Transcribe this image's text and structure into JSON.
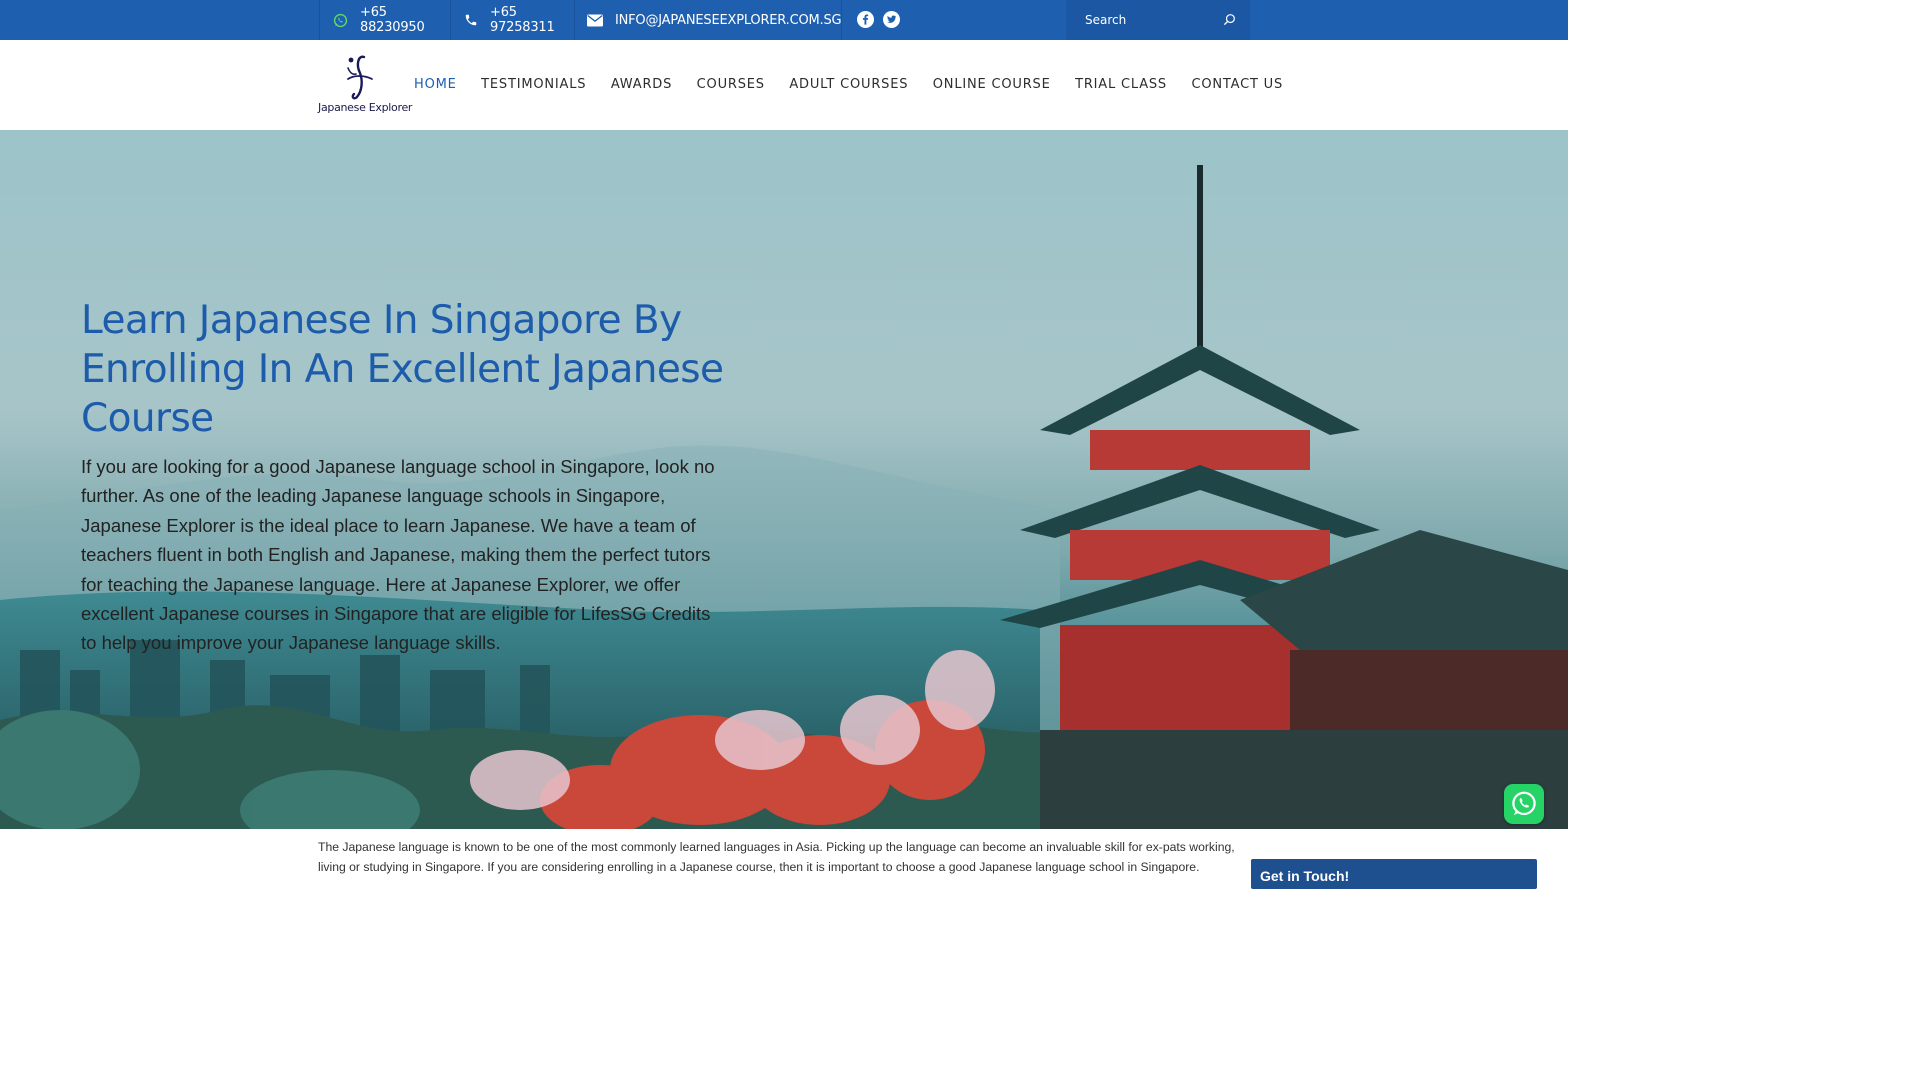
{
  "topbar": {
    "whatsapp": "+65 88230950",
    "phone": "+65 97258311",
    "email": "INFO@JAPANESEEXPLORER.COM.SG",
    "search_placeholder": "Search",
    "icons": [
      "whatsapp-icon",
      "phone-icon",
      "envelope-icon",
      "facebook-icon",
      "twitter-icon",
      "search-icon"
    ]
  },
  "header": {
    "logo_text": "Japanese Explorer",
    "nav": [
      "HOME",
      "TESTIMONIALS",
      "AWARDS",
      "COURSES",
      "ADULT COURSES",
      "ONLINE COURSE",
      "TRIAL CLASS",
      "CONTACT US"
    ],
    "active_index": 0
  },
  "hero": {
    "title": "Learn Japanese In Singapore By Enrolling In An Excellent Japanese Course",
    "text": "If you are looking for a good Japanese language school in Singapore, look no further. As one of the leading Japanese language schools in Singapore, Japanese Explorer is the ideal place to learn Japanese. We have a team of teachers fluent in both English and Japanese, making them the perfect tutors for teaching the Japanese language. Here at Japanese Explorer, we offer excellent Japanese courses in Singapore that are eligible for LifesSG Credits to help you improve your Japanese language skills."
  },
  "intro": {
    "text": "The Japanese language is known to be one of the most commonly learned languages in Asia. Picking up the language can become an invaluable skill for ex-pats working, living or studying in Singapore. If you are considering enrolling in a Japanese course, then it is important to choose a good Japanese language school in Singapore."
  },
  "sidebar": {
    "get_in_touch": "Get in Touch!"
  },
  "colors": {
    "topbar": "#1e5fb0",
    "accent": "#1d5bab",
    "whatsapp": "#25d366",
    "get_in_touch_bg": "#1e4f8f"
  }
}
